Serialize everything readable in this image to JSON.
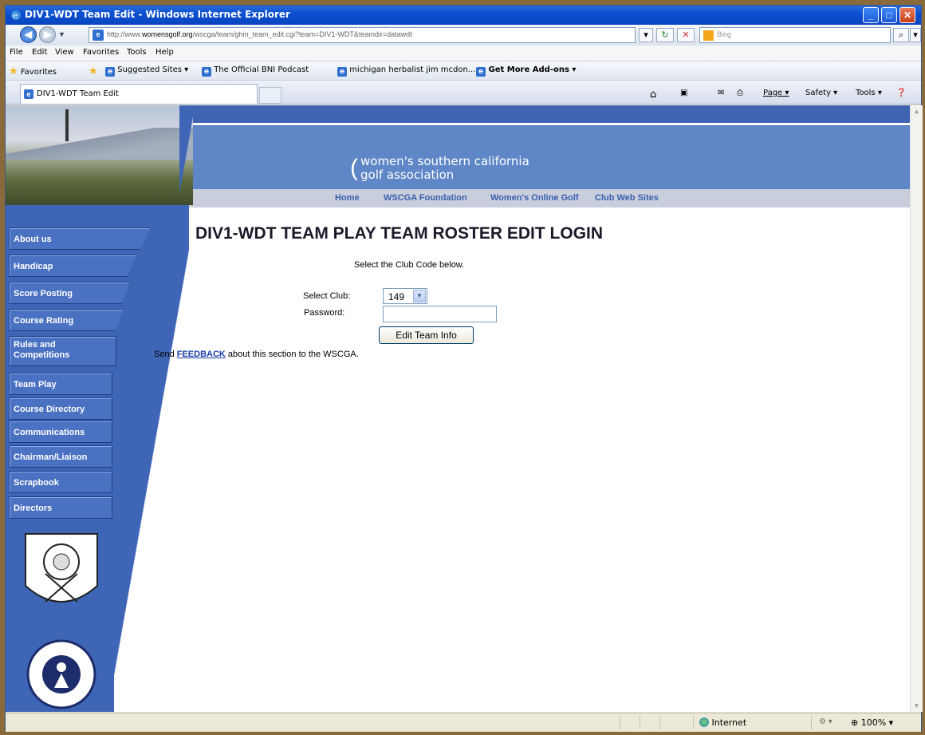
{
  "window": {
    "title": "DIV1-WDT Team Edit - Windows Internet Explorer",
    "url_prefix": "http://www.",
    "url_domain": "womensgolf.org",
    "url_path": "/wscga/team/ghin_team_edit.cgi?team=DIV1-WDT&teamdir=datawdt",
    "search_placeholder": "Bing"
  },
  "menu": [
    "File",
    "Edit",
    "View",
    "Favorites",
    "Tools",
    "Help"
  ],
  "favorites_bar": {
    "favorites_label": "Favorites",
    "items": [
      "Suggested Sites ▾",
      "The Official BNI Podcast",
      "michigan herbalist jim mcdon...",
      "Get More Add-ons ▾"
    ]
  },
  "tab": {
    "label": "DIV1-WDT Team Edit"
  },
  "command_bar": {
    "page": "Page ▾",
    "safety": "Safety ▾",
    "tools": "Tools ▾"
  },
  "site": {
    "org_line1": "women's southern california",
    "org_line2": "golf association",
    "topnav": [
      "Home",
      "WSCGA Foundation",
      "Women's Online Golf",
      "Club Web Sites"
    ],
    "sidebar": [
      "About us",
      "Handicap",
      "Score Posting",
      "Course Rating",
      "Rules and Competitions",
      "Team Play",
      "Course Directory",
      "Communications",
      "Chairman/Liaison",
      "Scrapbook",
      "Directors"
    ]
  },
  "form": {
    "heading": "DIV1-WDT TEAM PLAY TEAM ROSTER EDIT LOGIN",
    "instruction": "Select the Club Code below.",
    "club_label": "Select Club:",
    "club_value": "149",
    "password_label": "Password:",
    "submit_label": "Edit Team Info",
    "feedback_pre": "Send ",
    "feedback_link": "FEEDBACK",
    "feedback_post": " about this section to the WSCGA."
  },
  "status": {
    "zone": "Internet",
    "zoom": "100%"
  },
  "colors": {
    "sidebar": "#3f65b7",
    "banner": "#5f86c6",
    "titlebar": "#0b4fd1"
  }
}
